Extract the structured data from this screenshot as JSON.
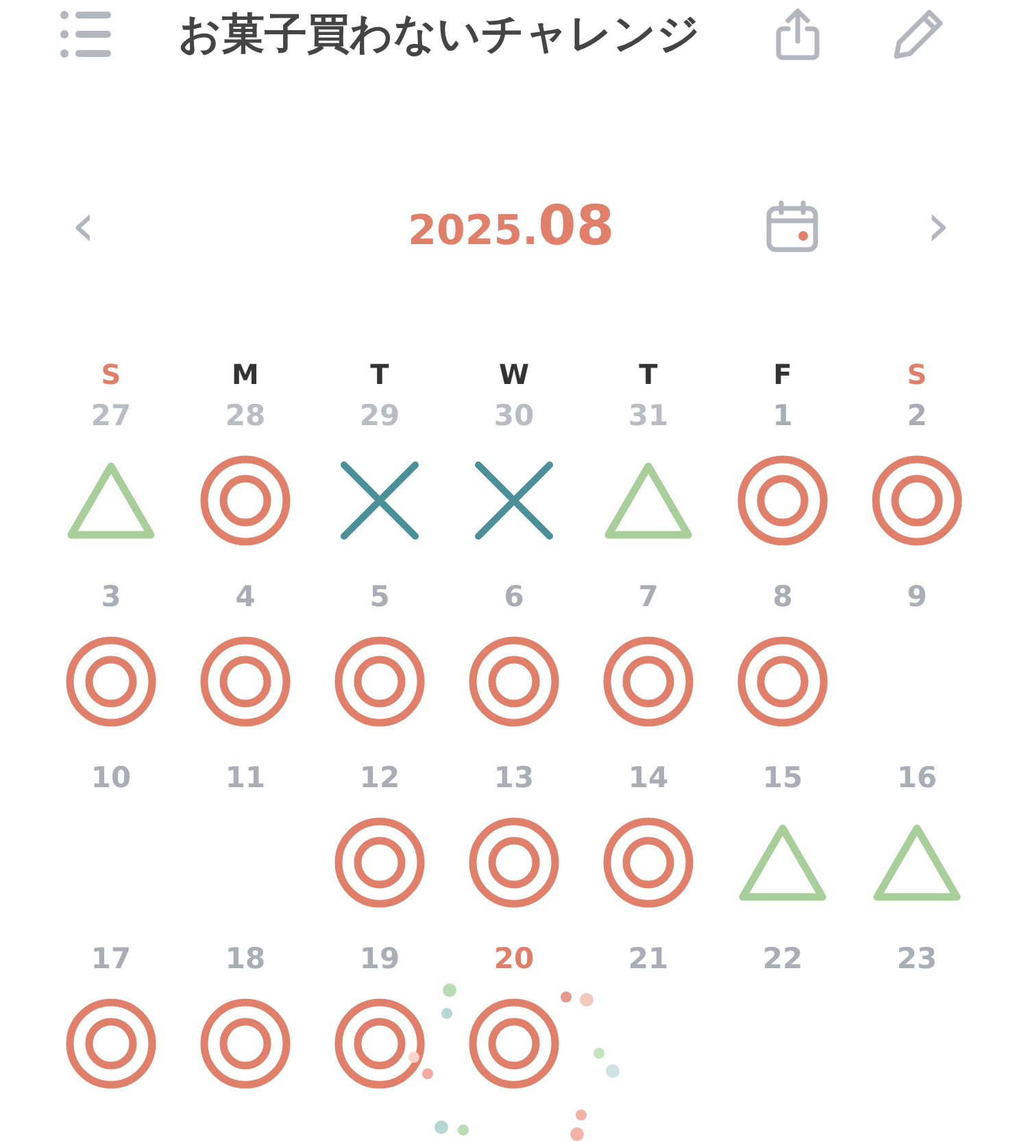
{
  "header": {
    "title": "お菓子買わないチャレンジ"
  },
  "month_nav": {
    "prev": "‹",
    "year": "2025.",
    "month": "08",
    "next": "›"
  },
  "weekdays": [
    {
      "label": "S",
      "weekend": true
    },
    {
      "label": "M",
      "weekend": false
    },
    {
      "label": "T",
      "weekend": false
    },
    {
      "label": "W",
      "weekend": false
    },
    {
      "label": "T",
      "weekend": false
    },
    {
      "label": "F",
      "weekend": false
    },
    {
      "label": "S",
      "weekend": true
    }
  ],
  "weeks": [
    [
      {
        "date": "27",
        "in_month": false,
        "today": false,
        "kind": "triangle"
      },
      {
        "date": "28",
        "in_month": false,
        "today": false,
        "kind": "double_circle"
      },
      {
        "date": "29",
        "in_month": false,
        "today": false,
        "kind": "cross"
      },
      {
        "date": "30",
        "in_month": false,
        "today": false,
        "kind": "cross"
      },
      {
        "date": "31",
        "in_month": false,
        "today": false,
        "kind": "triangle"
      },
      {
        "date": "1",
        "in_month": true,
        "today": false,
        "kind": "double_circle"
      },
      {
        "date": "2",
        "in_month": true,
        "today": false,
        "kind": "double_circle"
      }
    ],
    [
      {
        "date": "3",
        "in_month": true,
        "today": false,
        "kind": "double_circle"
      },
      {
        "date": "4",
        "in_month": true,
        "today": false,
        "kind": "double_circle"
      },
      {
        "date": "5",
        "in_month": true,
        "today": false,
        "kind": "double_circle"
      },
      {
        "date": "6",
        "in_month": true,
        "today": false,
        "kind": "double_circle"
      },
      {
        "date": "7",
        "in_month": true,
        "today": false,
        "kind": "double_circle"
      },
      {
        "date": "8",
        "in_month": true,
        "today": false,
        "kind": "double_circle"
      },
      {
        "date": "9",
        "in_month": true,
        "today": false
      }
    ],
    [
      {
        "date": "10",
        "in_month": true,
        "today": false
      },
      {
        "date": "11",
        "in_month": true,
        "today": false
      },
      {
        "date": "12",
        "in_month": true,
        "today": false,
        "kind": "double_circle"
      },
      {
        "date": "13",
        "in_month": true,
        "today": false,
        "kind": "double_circle"
      },
      {
        "date": "14",
        "in_month": true,
        "today": false,
        "kind": "double_circle"
      },
      {
        "date": "15",
        "in_month": true,
        "today": false,
        "kind": "triangle"
      },
      {
        "date": "16",
        "in_month": true,
        "today": false,
        "kind": "triangle"
      }
    ],
    [
      {
        "date": "17",
        "in_month": true,
        "today": false,
        "kind": "double_circle"
      },
      {
        "date": "18",
        "in_month": true,
        "today": false,
        "kind": "double_circle"
      },
      {
        "date": "19",
        "in_month": true,
        "today": false,
        "kind": "double_circle"
      },
      {
        "date": "20",
        "in_month": true,
        "today": true,
        "kind": "double_circle"
      },
      {
        "date": "21",
        "in_month": true,
        "today": false
      },
      {
        "date": "22",
        "in_month": true,
        "today": false
      },
      {
        "date": "23",
        "in_month": true,
        "today": false
      }
    ]
  ]
}
